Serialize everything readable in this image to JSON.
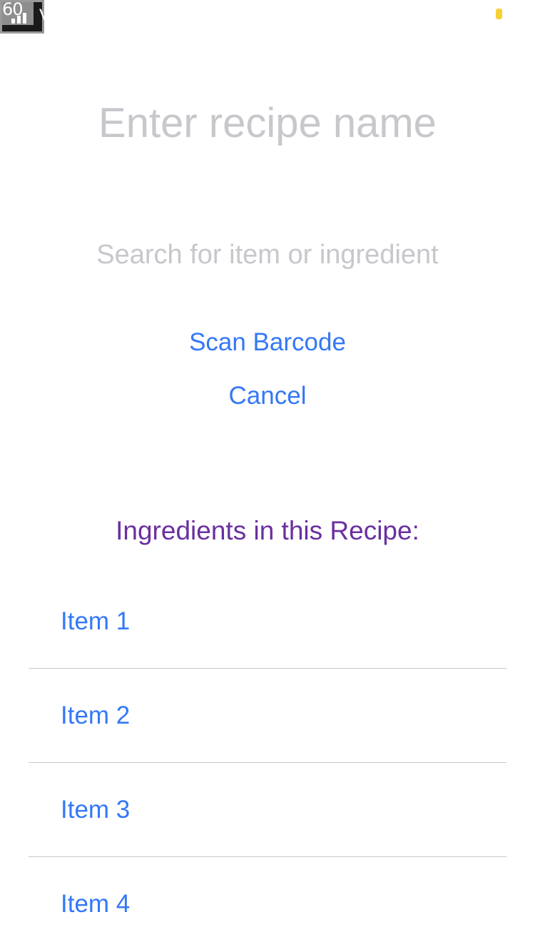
{
  "status_bar": {
    "fps": "60",
    "carrier": "V"
  },
  "recipe_name": {
    "placeholder": "Enter recipe name",
    "value": ""
  },
  "search": {
    "placeholder": "Search for item or ingredient",
    "value": ""
  },
  "actions": {
    "scan_label": "Scan Barcode",
    "cancel_label": "Cancel"
  },
  "ingredients": {
    "title": "Ingredients in this Recipe:",
    "items": [
      {
        "label": "Item 1"
      },
      {
        "label": "Item 2"
      },
      {
        "label": "Item 3"
      },
      {
        "label": "Item 4"
      }
    ]
  },
  "colors": {
    "link": "#3478f6",
    "section_title": "#6a2fa0",
    "placeholder": "#c7c7cc",
    "separator": "#c8c8cc",
    "battery": "#f5d133"
  }
}
